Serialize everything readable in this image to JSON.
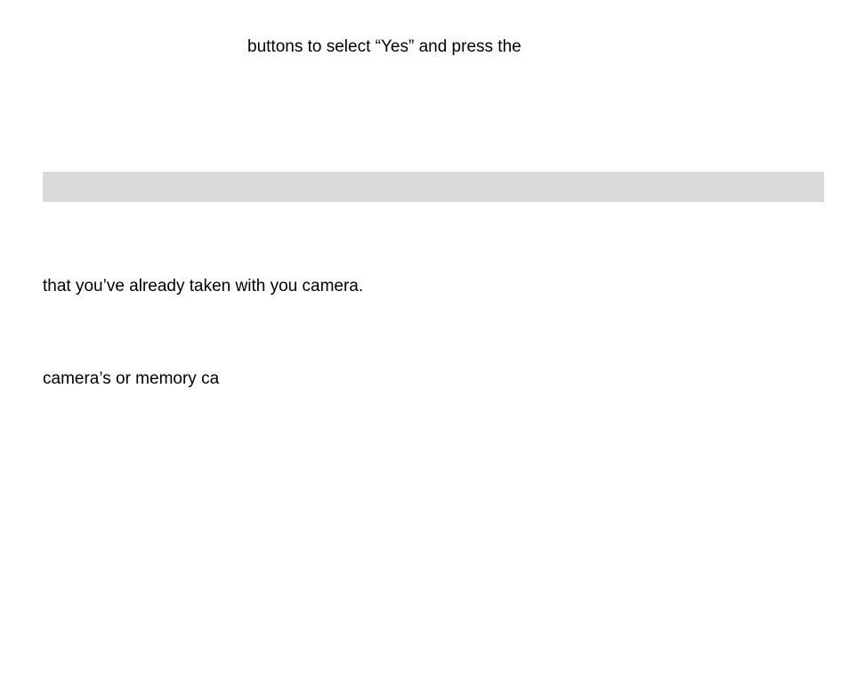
{
  "lines": {
    "l1": "buttons to select “Yes” and press the",
    "l2": "that you’ve already taken with you camera.",
    "l3": "camera’s or memory ca"
  }
}
